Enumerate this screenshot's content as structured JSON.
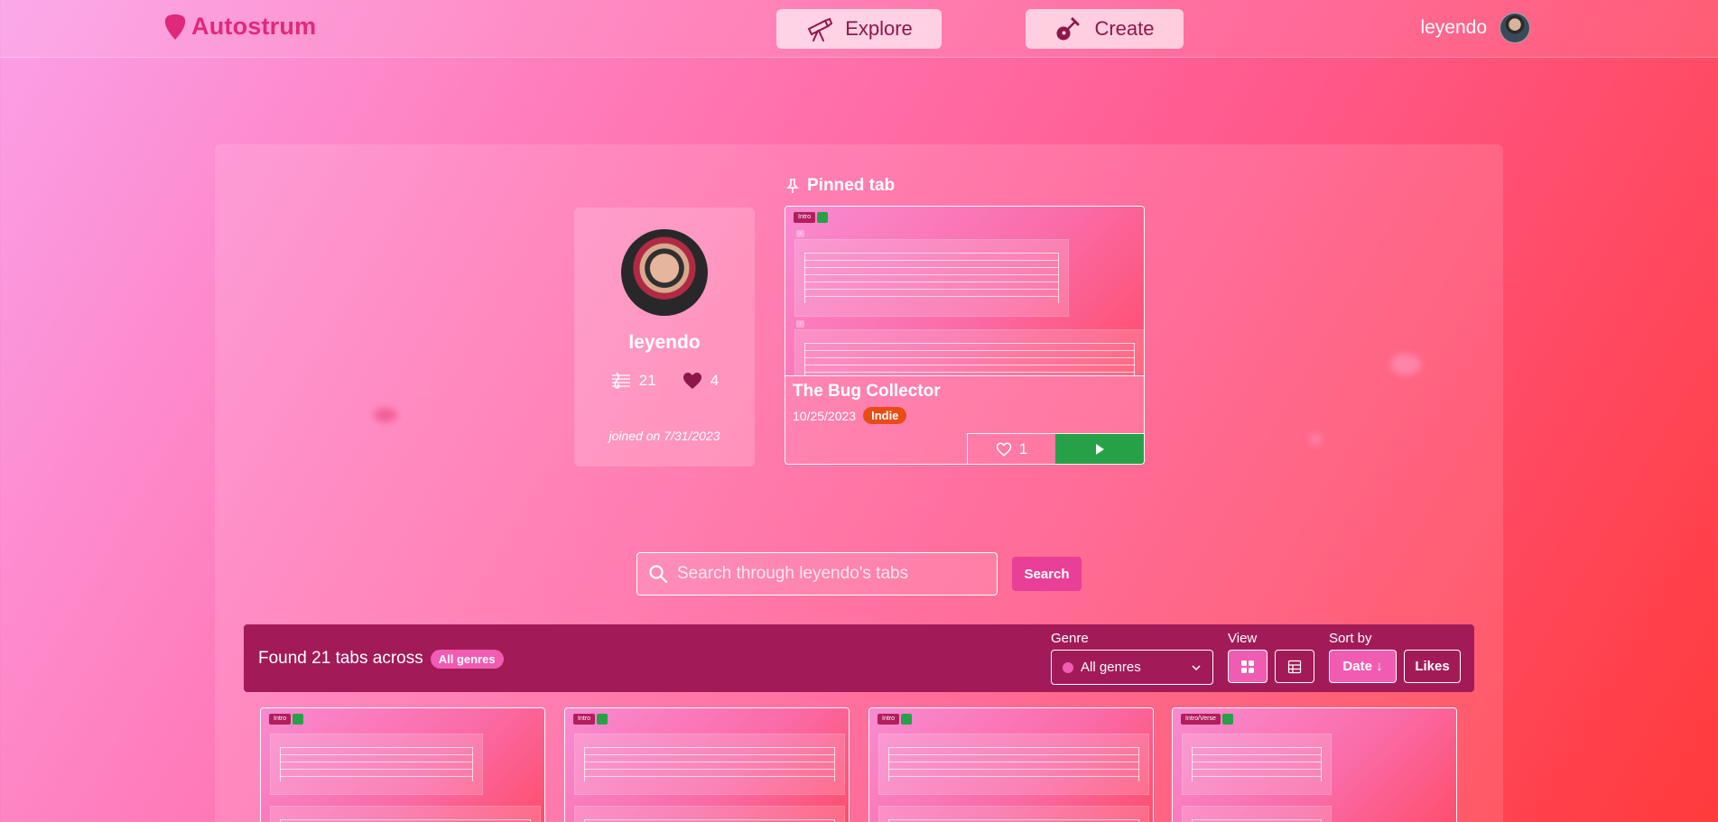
{
  "app": {
    "name": "Autostrum"
  },
  "nav": {
    "explore_label": "Explore",
    "create_label": "Create"
  },
  "user": {
    "name": "leyendo"
  },
  "profile": {
    "name": "leyendo",
    "tab_count": "21",
    "like_count": "4",
    "joined": "joined on 7/31/2023"
  },
  "pinned": {
    "heading": "Pinned tab",
    "tab": {
      "preview_section": "Intro",
      "title": "The Bug Collector",
      "date": "10/25/2023",
      "genre": "Indie",
      "likes": "1"
    }
  },
  "search": {
    "placeholder": "Search through leyendo's tabs",
    "value": "",
    "button_label": "Search"
  },
  "results": {
    "prefix": "Found 21 tabs across",
    "genre_badge": "All genres",
    "genre_label": "Genre",
    "genre_selected": "All genres",
    "view_label": "View",
    "sort_label": "Sort by",
    "sort_date_label": "Date ↓",
    "sort_likes_label": "Likes"
  },
  "grid_previews": [
    {
      "section": "Intro"
    },
    {
      "section": "Intro"
    },
    {
      "section": "Intro"
    },
    {
      "section": "Intro/Verse"
    }
  ],
  "colors": {
    "accent": "#e0297a",
    "results_bar": "#a21b58",
    "play_green": "#26a148",
    "genre_indie": "#e84d16",
    "badge_pink": "#f05cb1"
  }
}
